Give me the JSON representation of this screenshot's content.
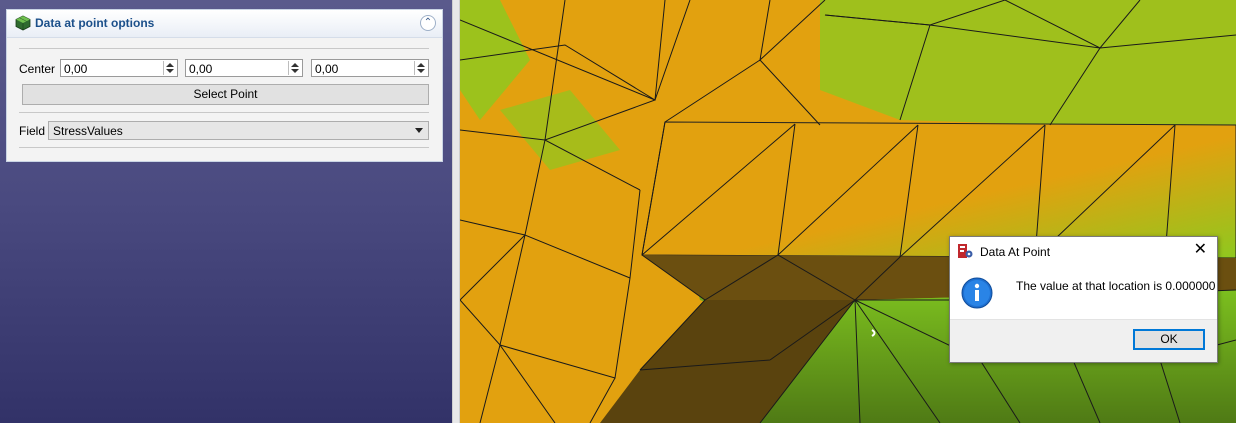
{
  "panel": {
    "title": "Data at point options",
    "center_label": "Center",
    "center_x": "0,00",
    "center_y": "0,00",
    "center_z": "0,00",
    "select_point_label": "Select Point",
    "field_label": "Field",
    "field_value": "StressValues"
  },
  "dialog": {
    "title": "Data At Point",
    "message": "The value at that location is 0.000000",
    "ok_label": "OK"
  },
  "colors": {
    "mesh_orange": "#e2a10f",
    "mesh_green": "#7cbf1f",
    "mesh_shadow": "#6b4f10",
    "panel_title": "#1b4f8a",
    "info_blue": "#1e6fd0"
  },
  "icons": {
    "panel_icon": "mesh-cube-icon",
    "collapse": "double-chevron-up-icon",
    "dialog_app": "freecad-app-icon",
    "dialog_close": "close-icon",
    "dialog_info": "info-icon"
  }
}
